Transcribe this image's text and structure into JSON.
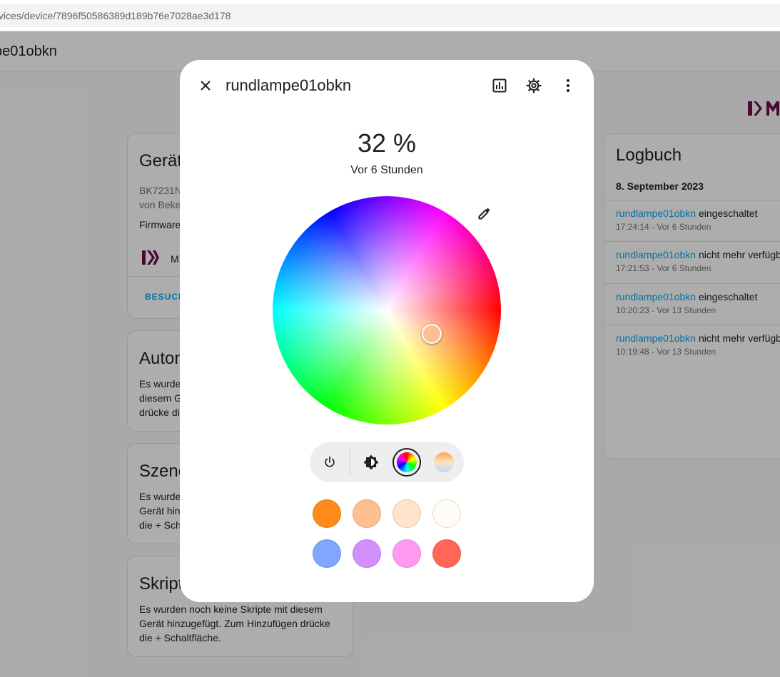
{
  "browser": {
    "url": "vices/device/7896f50586389d189b76e7028ae3d178"
  },
  "page": {
    "title": "pe01obkn",
    "device_card": {
      "title": "Gerät",
      "model": "BK7231N",
      "manufacturer": "von Beke",
      "firmware": "Firmware",
      "integration_label": "M",
      "visit_link": "BESUCH"
    },
    "automations_card": {
      "title": "Auton",
      "text_lines": [
        "Es wurde",
        "diesem G",
        "drücke di"
      ]
    },
    "scenes_card": {
      "title": "Szene",
      "text_lines": [
        "Es wurde",
        "Gerät hin",
        "die + Sch"
      ]
    },
    "scripts_card": {
      "title": "Skript",
      "text_lines": [
        "Es wurden noch keine Skripte mit diesem",
        "Gerät hinzugefügt. Zum Hinzufügen drücke",
        "die + Schaltfläche."
      ]
    },
    "logbook": {
      "title": "Logbuch",
      "date": "8. September 2023",
      "entries": [
        {
          "entity": "rundlampe01obkn",
          "action": "eingeschaltet",
          "time": "17:24:14 - Vor 6 Stunden"
        },
        {
          "entity": "rundlampe01obkn",
          "action": "nicht mehr verfügb",
          "time": "17:21:53 - Vor 6 Stunden"
        },
        {
          "entity": "rundlampe01obkn",
          "action": "eingeschaltet",
          "time": "10:20:23 - Vor 13 Stunden"
        },
        {
          "entity": "rundlampe01obkn",
          "action": "nicht mehr verfügb",
          "time": "10:19:48 - Vor 13 Stunden"
        }
      ]
    }
  },
  "dialog": {
    "title": "rundlampe01obkn",
    "brightness": "32 %",
    "last_changed": "Vor 6 Stunden",
    "selected_color": "#ffbf90",
    "modes": [
      "power-icon",
      "brightness-icon",
      "color-wheel-mode",
      "color-temp-mode"
    ],
    "active_mode": "color-wheel-mode",
    "favorite_colors": [
      "#ff8c1a",
      "#ffbf90",
      "#ffe4cc",
      "#fffcf5",
      "#7fa7ff",
      "#d48fff",
      "#ff99f2",
      "#ff6655"
    ]
  }
}
